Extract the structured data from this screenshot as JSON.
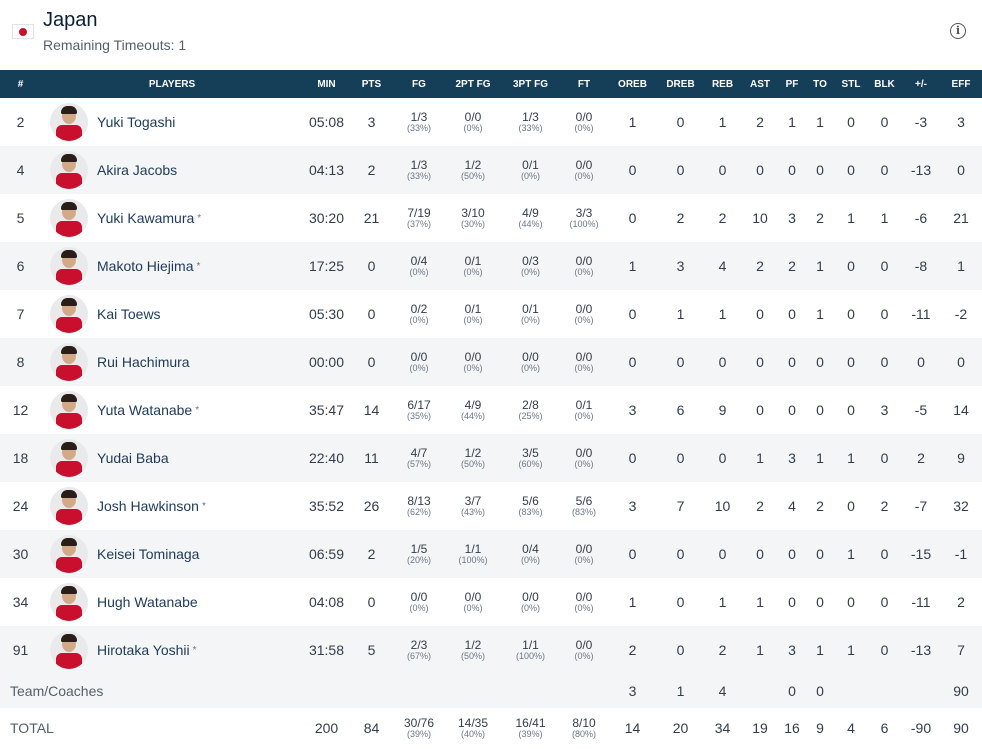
{
  "team": {
    "name": "Japan",
    "timeouts": "Remaining Timeouts: 1",
    "flag_icon": "japan-flag-icon",
    "info_icon": "info-icon",
    "accent": "#153e59",
    "flag_color": "#c8102e"
  },
  "headers": [
    "#",
    "PLAYERS",
    "MIN",
    "PTS",
    "FG",
    "2PT FG",
    "3PT FG",
    "FT",
    "OREB",
    "DREB",
    "REB",
    "AST",
    "PF",
    "TO",
    "STL",
    "BLK",
    "+/-",
    "EFF"
  ],
  "players": [
    {
      "num": "2",
      "name": "Yuki Togashi",
      "star": "",
      "min": "05:08",
      "pts": "3",
      "fg": "1/3",
      "fg_pct": "(33%)",
      "fg2": "0/0",
      "fg2_pct": "(0%)",
      "fg3": "1/3",
      "fg3_pct": "(33%)",
      "ft": "0/0",
      "ft_pct": "(0%)",
      "oreb": "1",
      "dreb": "0",
      "reb": "1",
      "ast": "2",
      "pf": "1",
      "to": "1",
      "stl": "0",
      "blk": "0",
      "pm": "-3",
      "eff": "3"
    },
    {
      "num": "4",
      "name": "Akira Jacobs",
      "star": "",
      "min": "04:13",
      "pts": "2",
      "fg": "1/3",
      "fg_pct": "(33%)",
      "fg2": "1/2",
      "fg2_pct": "(50%)",
      "fg3": "0/1",
      "fg3_pct": "(0%)",
      "ft": "0/0",
      "ft_pct": "(0%)",
      "oreb": "0",
      "dreb": "0",
      "reb": "0",
      "ast": "0",
      "pf": "0",
      "to": "0",
      "stl": "0",
      "blk": "0",
      "pm": "-13",
      "eff": "0"
    },
    {
      "num": "5",
      "name": "Yuki Kawamura",
      "star": "*",
      "min": "30:20",
      "pts": "21",
      "fg": "7/19",
      "fg_pct": "(37%)",
      "fg2": "3/10",
      "fg2_pct": "(30%)",
      "fg3": "4/9",
      "fg3_pct": "(44%)",
      "ft": "3/3",
      "ft_pct": "(100%)",
      "oreb": "0",
      "dreb": "2",
      "reb": "2",
      "ast": "10",
      "pf": "3",
      "to": "2",
      "stl": "1",
      "blk": "1",
      "pm": "-6",
      "eff": "21"
    },
    {
      "num": "6",
      "name": "Makoto Hiejima",
      "star": "*",
      "min": "17:25",
      "pts": "0",
      "fg": "0/4",
      "fg_pct": "(0%)",
      "fg2": "0/1",
      "fg2_pct": "(0%)",
      "fg3": "0/3",
      "fg3_pct": "(0%)",
      "ft": "0/0",
      "ft_pct": "(0%)",
      "oreb": "1",
      "dreb": "3",
      "reb": "4",
      "ast": "2",
      "pf": "2",
      "to": "1",
      "stl": "0",
      "blk": "0",
      "pm": "-8",
      "eff": "1"
    },
    {
      "num": "7",
      "name": "Kai Toews",
      "star": "",
      "min": "05:30",
      "pts": "0",
      "fg": "0/2",
      "fg_pct": "(0%)",
      "fg2": "0/1",
      "fg2_pct": "(0%)",
      "fg3": "0/1",
      "fg3_pct": "(0%)",
      "ft": "0/0",
      "ft_pct": "(0%)",
      "oreb": "0",
      "dreb": "1",
      "reb": "1",
      "ast": "0",
      "pf": "0",
      "to": "1",
      "stl": "0",
      "blk": "0",
      "pm": "-11",
      "eff": "-2"
    },
    {
      "num": "8",
      "name": "Rui Hachimura",
      "star": "",
      "min": "00:00",
      "pts": "0",
      "fg": "0/0",
      "fg_pct": "(0%)",
      "fg2": "0/0",
      "fg2_pct": "(0%)",
      "fg3": "0/0",
      "fg3_pct": "(0%)",
      "ft": "0/0",
      "ft_pct": "(0%)",
      "oreb": "0",
      "dreb": "0",
      "reb": "0",
      "ast": "0",
      "pf": "0",
      "to": "0",
      "stl": "0",
      "blk": "0",
      "pm": "0",
      "eff": "0"
    },
    {
      "num": "12",
      "name": "Yuta Watanabe",
      "star": "*",
      "min": "35:47",
      "pts": "14",
      "fg": "6/17",
      "fg_pct": "(35%)",
      "fg2": "4/9",
      "fg2_pct": "(44%)",
      "fg3": "2/8",
      "fg3_pct": "(25%)",
      "ft": "0/1",
      "ft_pct": "(0%)",
      "oreb": "3",
      "dreb": "6",
      "reb": "9",
      "ast": "0",
      "pf": "0",
      "to": "0",
      "stl": "0",
      "blk": "3",
      "pm": "-5",
      "eff": "14"
    },
    {
      "num": "18",
      "name": "Yudai Baba",
      "star": "",
      "min": "22:40",
      "pts": "11",
      "fg": "4/7",
      "fg_pct": "(57%)",
      "fg2": "1/2",
      "fg2_pct": "(50%)",
      "fg3": "3/5",
      "fg3_pct": "(60%)",
      "ft": "0/0",
      "ft_pct": "(0%)",
      "oreb": "0",
      "dreb": "0",
      "reb": "0",
      "ast": "1",
      "pf": "3",
      "to": "1",
      "stl": "1",
      "blk": "0",
      "pm": "2",
      "eff": "9"
    },
    {
      "num": "24",
      "name": "Josh Hawkinson",
      "star": "*",
      "min": "35:52",
      "pts": "26",
      "fg": "8/13",
      "fg_pct": "(62%)",
      "fg2": "3/7",
      "fg2_pct": "(43%)",
      "fg3": "5/6",
      "fg3_pct": "(83%)",
      "ft": "5/6",
      "ft_pct": "(83%)",
      "oreb": "3",
      "dreb": "7",
      "reb": "10",
      "ast": "2",
      "pf": "4",
      "to": "2",
      "stl": "0",
      "blk": "2",
      "pm": "-7",
      "eff": "32"
    },
    {
      "num": "30",
      "name": "Keisei Tominaga",
      "star": "",
      "min": "06:59",
      "pts": "2",
      "fg": "1/5",
      "fg_pct": "(20%)",
      "fg2": "1/1",
      "fg2_pct": "(100%)",
      "fg3": "0/4",
      "fg3_pct": "(0%)",
      "ft": "0/0",
      "ft_pct": "(0%)",
      "oreb": "0",
      "dreb": "0",
      "reb": "0",
      "ast": "0",
      "pf": "0",
      "to": "0",
      "stl": "1",
      "blk": "0",
      "pm": "-15",
      "eff": "-1"
    },
    {
      "num": "34",
      "name": "Hugh Watanabe",
      "star": "",
      "min": "04:08",
      "pts": "0",
      "fg": "0/0",
      "fg_pct": "(0%)",
      "fg2": "0/0",
      "fg2_pct": "(0%)",
      "fg3": "0/0",
      "fg3_pct": "(0%)",
      "ft": "0/0",
      "ft_pct": "(0%)",
      "oreb": "1",
      "dreb": "0",
      "reb": "1",
      "ast": "1",
      "pf": "0",
      "to": "0",
      "stl": "0",
      "blk": "0",
      "pm": "-11",
      "eff": "2"
    },
    {
      "num": "91",
      "name": "Hirotaka Yoshii",
      "star": "*",
      "min": "31:58",
      "pts": "5",
      "fg": "2/3",
      "fg_pct": "(67%)",
      "fg2": "1/2",
      "fg2_pct": "(50%)",
      "fg3": "1/1",
      "fg3_pct": "(100%)",
      "ft": "0/0",
      "ft_pct": "(0%)",
      "oreb": "2",
      "dreb": "0",
      "reb": "2",
      "ast": "1",
      "pf": "3",
      "to": "1",
      "stl": "1",
      "blk": "0",
      "pm": "-13",
      "eff": "7"
    }
  ],
  "team_row": {
    "label": "Team/Coaches",
    "oreb": "3",
    "dreb": "1",
    "reb": "4",
    "pf": "0",
    "to": "0",
    "eff": "90"
  },
  "total_row": {
    "label": "TOTAL",
    "min": "200",
    "pts": "84",
    "fg": "30/76",
    "fg_pct": "(39%)",
    "fg2": "14/35",
    "fg2_pct": "(40%)",
    "fg3": "16/41",
    "fg3_pct": "(39%)",
    "ft": "8/10",
    "ft_pct": "(80%)",
    "oreb": "14",
    "dreb": "20",
    "reb": "34",
    "ast": "19",
    "pf": "16",
    "to": "9",
    "stl": "4",
    "blk": "6",
    "pm": "-90",
    "eff": "90"
  }
}
